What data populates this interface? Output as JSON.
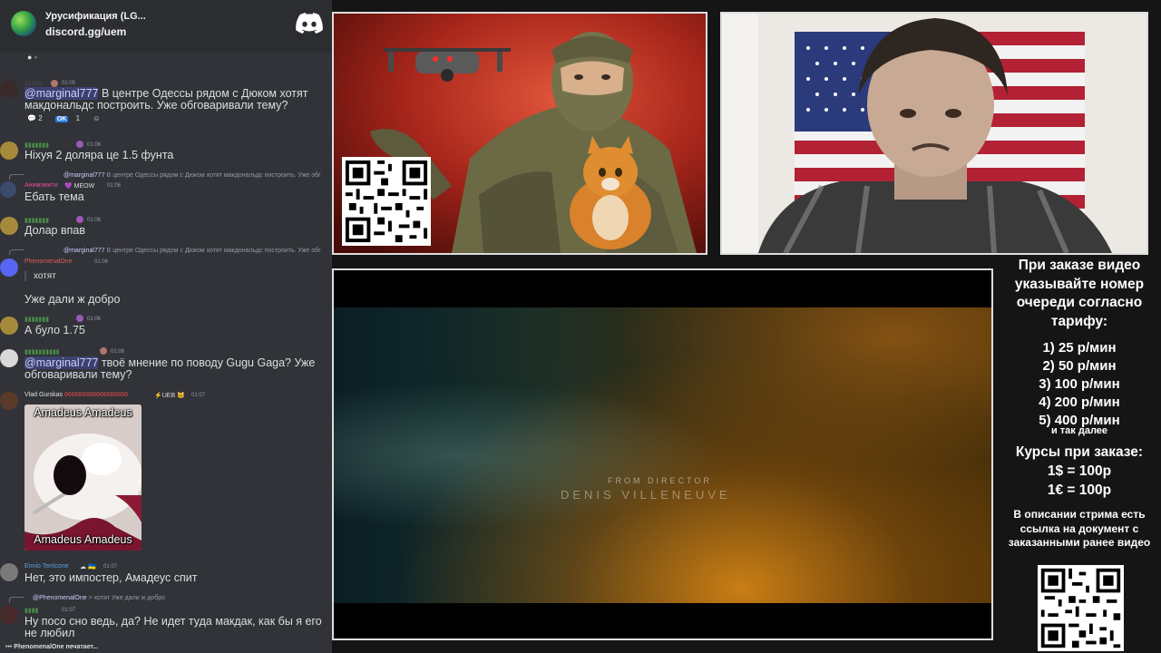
{
  "chat": {
    "server": {
      "name": "Урусификация (LG...",
      "invite": "discord.gg/uem"
    },
    "messages": [
      {
        "time": "01:05",
        "mention": "@marginal777",
        "text": " В центре Одессы рядом с Дюком хотят макдональдс построить.  Уже обговаривали тему?",
        "reactions": {
          "comments": "2",
          "ok_label": "OK",
          "ok_count": "1"
        }
      },
      {
        "time": "01:06",
        "text": "Ніхуя 2 доляра це 1.5 фунта"
      },
      {
        "reply_mention": "@marginal777",
        "reply_text": " В центре Одессы рядом с Дюком хотят макдональдс построить.  Уже обг",
        "username": "Анимэмити",
        "badge": "MEOW",
        "time": "01:06",
        "text": "Ебать тема"
      },
      {
        "time": "01:06",
        "text": "Долар впав"
      },
      {
        "reply_mention": "@marginal777",
        "reply_text": " В центре Одессы рядом с Дюком хотят макдональдс построить.  Уже обг",
        "username": "PhenomenalOne",
        "time": "01:06",
        "quote": "хотят",
        "text": "Уже дали ж добро"
      },
      {
        "time": "01:06",
        "text": "А було 1.75"
      },
      {
        "time": "01:06",
        "mention": "@marginal777",
        "text": " твоё мнение по поводу Gugu Gaga? Уже обговаривали тему?"
      },
      {
        "username": "Vlad Gurskas",
        "user_suffix": "666666666666666666",
        "badge": "UEB",
        "time": "01:07",
        "meme_top": "Amadeus Amadeus",
        "meme_bottom": "Amadeus Amadeus"
      },
      {
        "username": "Ennio Terricone",
        "time": "01:07",
        "text": "Нет, это импостер, Амадеус спит"
      },
      {
        "reply_mention": "@PhenomenalOne",
        "reply_text": " > хотят  Уже дали ж добро",
        "time": "01:07",
        "text": "Ну посо сно ведь, да? Не идет туда макдак, как бы я его не любил"
      }
    ],
    "typing": "PhenomenalOne печатает..."
  },
  "video": {
    "credit_small": "FROM DIRECTOR",
    "credit_big": "DENIS VILLENEUVE"
  },
  "info": {
    "heading": "При заказе видео указывайте номер очереди согласно тарифу:",
    "tariffs": [
      "1) 25 р/мин",
      "2) 50 р/мин",
      "3) 100 р/мин",
      "4) 200 р/мин",
      "5) 400 р/мин"
    ],
    "and_so_on": "и так далее",
    "rates_heading": "Курсы при заказе:",
    "rates": [
      "1$ = 100р",
      "1€ = 100р"
    ],
    "description": "В описании стрима есть ссылка на документ с заказанными ранее видео"
  },
  "colors": {
    "discord_bg": "#313338",
    "discord_header": "#2b2d31",
    "mention": "#c9cdfb",
    "username_green": "#4a8b48",
    "blurple": "#5865f2"
  }
}
